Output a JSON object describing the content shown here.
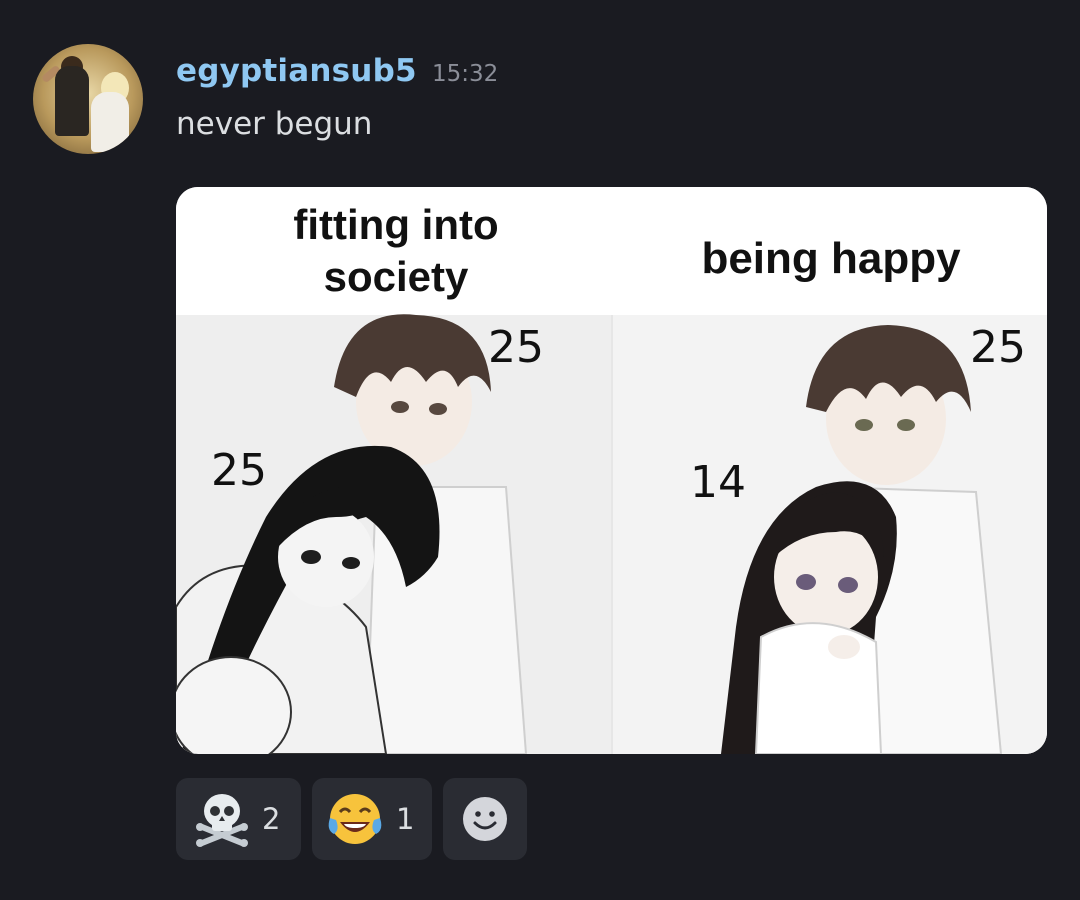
{
  "message": {
    "author": "egyptiansub5",
    "timestamp": "15:32",
    "text": "never begun",
    "author_color": "#8fc8f2"
  },
  "avatar": {
    "icon": "user-avatar-photo"
  },
  "attachment": {
    "left_panel": {
      "caption": "fitting into society",
      "caption_line1": "fitting into",
      "caption_line2": "society",
      "age_top": "25",
      "age_bottom": "25"
    },
    "right_panel": {
      "caption": "being happy",
      "age_top": "25",
      "age_bottom": "14"
    }
  },
  "reactions": [
    {
      "emoji_icon": "skull-and-crossbones-icon",
      "count": "2"
    },
    {
      "emoji_icon": "joy-tears-face-icon",
      "count": "1"
    },
    {
      "emoji_icon": "add-reaction-smiley-icon"
    }
  ]
}
